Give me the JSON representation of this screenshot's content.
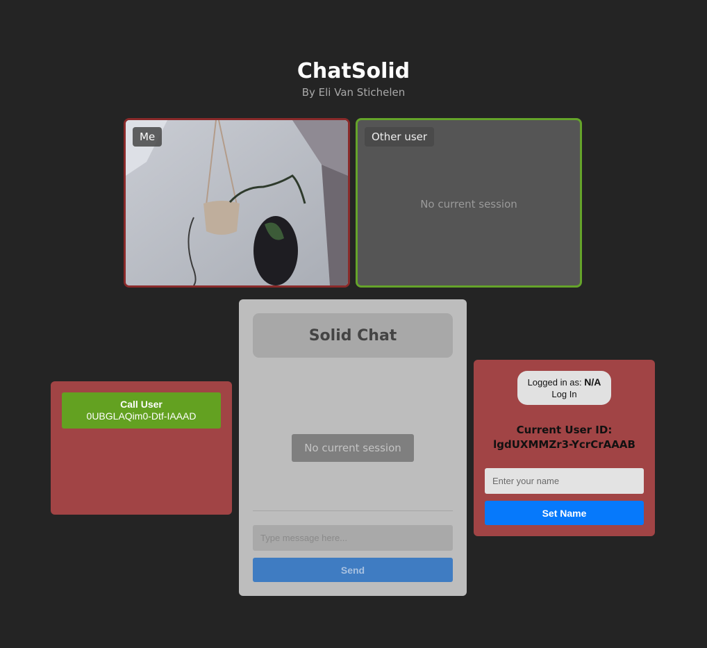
{
  "header": {
    "title": "ChatSolid",
    "subtitle": "By Eli Van Stichelen"
  },
  "video": {
    "me_label": "Me",
    "other_label": "Other user",
    "other_empty_text": "No current session"
  },
  "call_panel": {
    "button_label": "Call User",
    "target_id": "0UBGLAQim0-Dtf-IAAAD"
  },
  "chat": {
    "title": "Solid Chat",
    "session_status": "No current session",
    "message_placeholder": "Type message here...",
    "send_label": "Send"
  },
  "user_panel": {
    "logged_in_prefix": "Logged in as:",
    "logged_in_value": "N/A",
    "login_label": "Log In",
    "user_id_title": "Current User ID:",
    "user_id_value": "lgdUXMMZr3-YcrCrAAAB",
    "name_placeholder": "Enter your name",
    "set_name_label": "Set Name"
  },
  "colors": {
    "background": "#242424",
    "panel_red": "#a14445",
    "call_green": "#63a121",
    "me_border": "#8a2a2a",
    "other_border": "#65a42a",
    "set_name_blue": "#0679fb",
    "send_blue": "#3f7cc2"
  }
}
